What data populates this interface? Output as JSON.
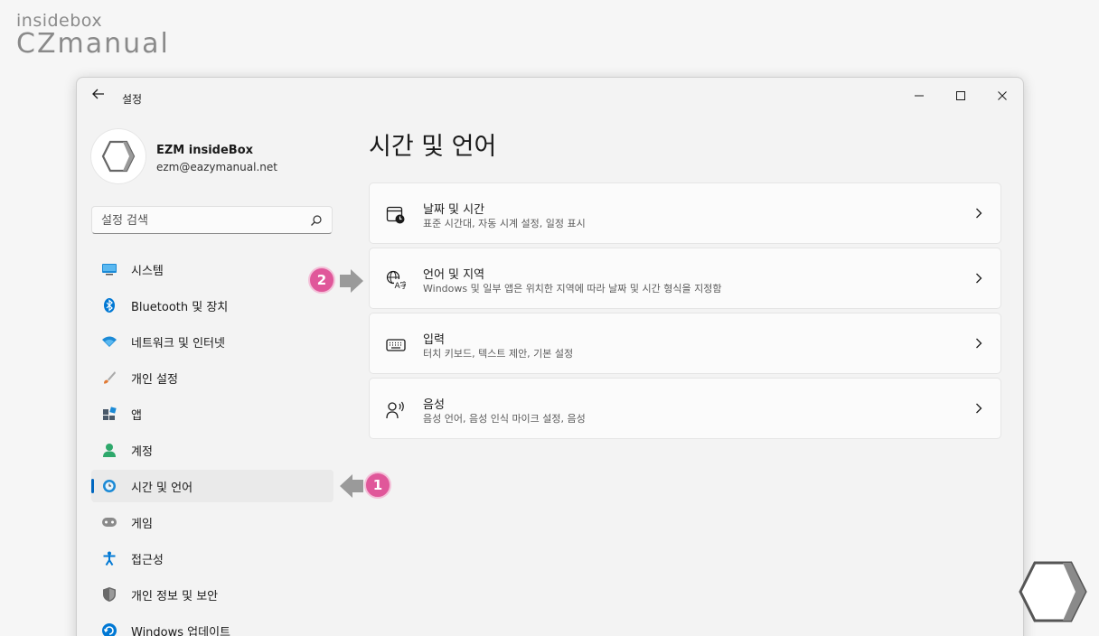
{
  "brand": {
    "top": "insidebox",
    "main": "CZmanual"
  },
  "window": {
    "title": "설정"
  },
  "profile": {
    "name": "EZM insideBox",
    "email": "ezm@eazymanual.net"
  },
  "search": {
    "placeholder": "설정 검색"
  },
  "nav": {
    "items": [
      {
        "label": "시스템",
        "icon": "monitor-icon",
        "color": "#1b8ad6"
      },
      {
        "label": "Bluetooth 및 장치",
        "icon": "bluetooth-icon",
        "color": "#0078d4"
      },
      {
        "label": "네트워크 및 인터넷",
        "icon": "wifi-icon",
        "color": "#1b8ad6"
      },
      {
        "label": "개인 설정",
        "icon": "brush-icon",
        "color": "#e07a35"
      },
      {
        "label": "앱",
        "icon": "apps-icon",
        "color": "#4a5a6a"
      },
      {
        "label": "계정",
        "icon": "account-icon",
        "color": "#2ea86b"
      },
      {
        "label": "시간 및 언어",
        "icon": "globe-clock-icon",
        "color": "#1b8ad6",
        "selected": true
      },
      {
        "label": "게임",
        "icon": "gamepad-icon",
        "color": "#8a8a8a"
      },
      {
        "label": "접근성",
        "icon": "accessibility-icon",
        "color": "#0078d4"
      },
      {
        "label": "개인 정보 및 보안",
        "icon": "shield-icon",
        "color": "#6a6a6a"
      },
      {
        "label": "Windows 업데이트",
        "icon": "update-icon",
        "color": "#0078d4"
      }
    ]
  },
  "main": {
    "title": "시간 및 언어",
    "cards": [
      {
        "title": "날짜 및 시간",
        "desc": "표준 시간대, 자동 시계 설정, 일정 표시",
        "icon": "calendar-clock-icon"
      },
      {
        "title": "언어 및 지역",
        "desc": "Windows 및 일부 앱은 위치한 지역에 따라 날짜 및 시간 형식을 지정함",
        "icon": "language-icon"
      },
      {
        "title": "입력",
        "desc": "터치 키보드, 텍스트 제안, 기본 설정",
        "icon": "keyboard-icon"
      },
      {
        "title": "음성",
        "desc": "음성 언어, 음성 인식 마이크 설정, 음성",
        "icon": "speech-icon"
      }
    ]
  },
  "annotations": {
    "step1": "1",
    "step2": "2",
    "color": "#e0579a"
  },
  "colors": {
    "accent": "#0067c0"
  }
}
